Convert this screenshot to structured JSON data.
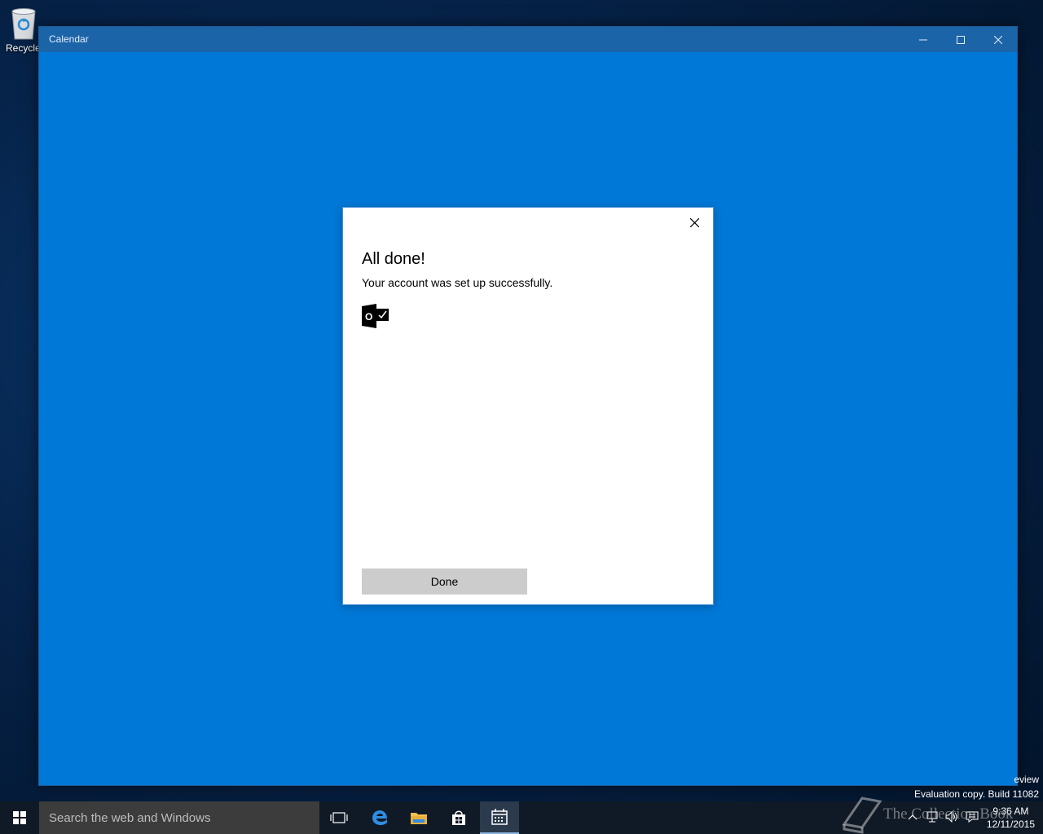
{
  "desktop": {
    "recycle_label": "Recycle"
  },
  "window": {
    "title": "Calendar",
    "bg_color": "#0078d7"
  },
  "dialog": {
    "heading": "All done!",
    "message": "Your account was set up successfully.",
    "account_icon_letter": "O",
    "done_label": "Done"
  },
  "watermark": {
    "line1": "eview",
    "line2": "Evaluation copy. Build 11082",
    "brand": "The Collection Book"
  },
  "taskbar": {
    "search_placeholder": "Search the web and Windows",
    "time": "9:36 AM",
    "date": "12/11/2015"
  }
}
